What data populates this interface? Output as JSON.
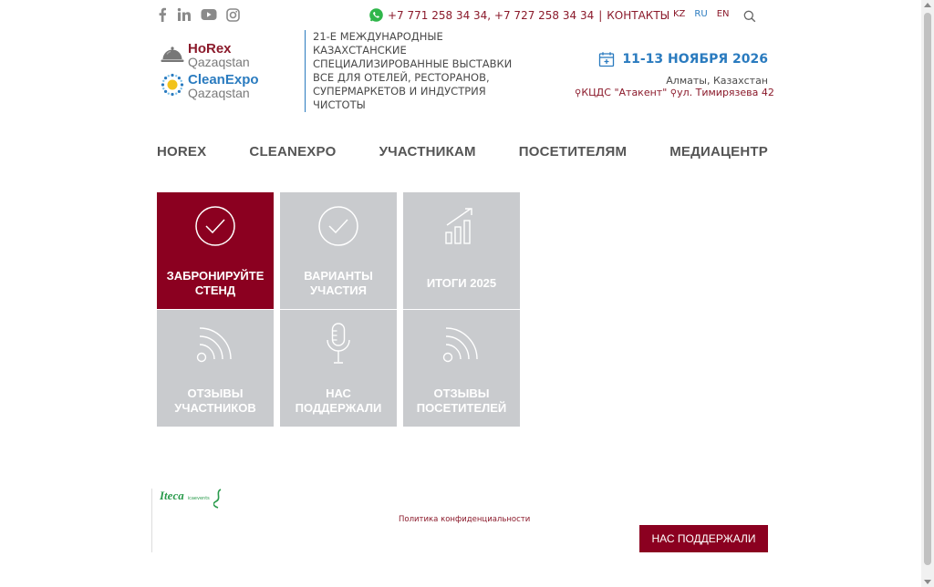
{
  "topbar": {
    "social": [
      {
        "icon": "facebook-icon"
      },
      {
        "icon": "linkedin-icon"
      },
      {
        "icon": "youtube-icon"
      },
      {
        "icon": "instagram-icon"
      }
    ],
    "phones": "+7 771 258 34 34, +7 727 258 34 34",
    "separator": "|",
    "contacts_label": "КОНТАКТЫ",
    "languages": [
      "KZ",
      "RU",
      "EN"
    ],
    "active_language": "RU"
  },
  "logos": {
    "horex": {
      "line1": "HoRex",
      "line2": "Qazaqstan"
    },
    "cleanexpo": {
      "line1": "CleanExpo",
      "line2": "Qazaqstan"
    }
  },
  "tagline": "21-Е МЕЖДУНАРОДНЫЕ КАЗАХСТАНСКИЕ СПЕЦИАЛИЗИРОВАННЫЕ ВЫСТАВКИ ВСЕ ДЛЯ ОТЕЛЕЙ, РЕСТОРАНОВ, СУПЕРМАРКЕТОВ И ИНДУСТРИЯ ЧИСТОТЫ",
  "event": {
    "date": "11-13 НОЯБРЯ 2026",
    "city": "Алматы, Казахстан",
    "venue": "КЦДС \"Атакент\"",
    "address": "ул. Тимирязева 42"
  },
  "nav": [
    "HOREX",
    "CLEANEXPO",
    "УЧАСТНИКАМ",
    "ПОСЕТИТЕЛЯМ",
    "МЕДИАЦЕНТР"
  ],
  "tiles": [
    {
      "label": "ЗАБРОНИРУЙТЕ СТЕНД",
      "icon": "check-circle-icon",
      "active": true
    },
    {
      "label": "ВАРИАНТЫ УЧАСТИЯ",
      "icon": "check-circle-icon",
      "active": false
    },
    {
      "label": "ИТОГИ 2025",
      "icon": "growth-chart-icon",
      "active": false
    },
    {
      "label": "ОТЗЫВЫ УЧАСТНИКОВ",
      "icon": "signal-waves-icon",
      "active": false
    },
    {
      "label": "НАС ПОДДЕРЖАЛИ",
      "icon": "microphone-icon",
      "active": false
    },
    {
      "label": "ОТЗЫВЫ ПОСЕТИТЕЛЕЙ",
      "icon": "signal-waves-icon",
      "active": false
    }
  ],
  "footer": {
    "iteca": "Iteca",
    "icaevents": "icaevents",
    "privacy": "Политика конфиденциальности",
    "support_button": "НАС ПОДДЕРЖАЛИ"
  },
  "colors": {
    "brand": "#8b0020",
    "accent_blue": "#2a7bbf",
    "tile_gray": "#c9cbce"
  }
}
